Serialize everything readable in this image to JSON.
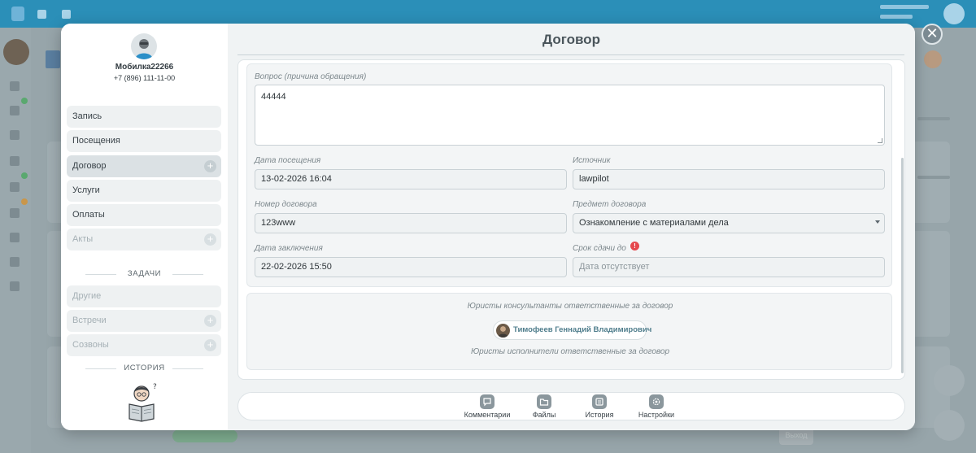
{
  "profile": {
    "name": "Мобилка22266",
    "phone": "+7 (896) 111-11-00"
  },
  "nav": {
    "items": [
      {
        "label": "Запись"
      },
      {
        "label": "Посещения"
      },
      {
        "label": "Договор"
      },
      {
        "label": "Услуги"
      },
      {
        "label": "Оплаты"
      },
      {
        "label": "Акты"
      }
    ],
    "tasks_heading": "ЗАДАЧИ",
    "tasks": [
      {
        "label": "Другие"
      },
      {
        "label": "Встречи"
      },
      {
        "label": "Созвоны"
      }
    ],
    "history_heading": "ИСТОРИЯ"
  },
  "modal": {
    "title": "Договор",
    "close_symbol": "✕"
  },
  "form": {
    "question": {
      "label": "Вопрос (причина обращения)",
      "value": "44444"
    },
    "visit_date": {
      "label": "Дата посещения",
      "value": "13-02-2026 16:04"
    },
    "source": {
      "label": "Источник",
      "value": "lawpilot"
    },
    "contract_number": {
      "label": "Номер договора",
      "value": "123www"
    },
    "contract_subject": {
      "label": "Предмет договора",
      "value": "Ознакомление с материалами дела"
    },
    "conclusion_date": {
      "label": "Дата заключения",
      "value": "22-02-2026 15:50"
    },
    "deadline": {
      "label": "Срок сдачи до",
      "warning_symbol": "!",
      "placeholder": "Дата отсутствует"
    }
  },
  "lawyers": {
    "consultants_label": "Юристы консультанты ответственные за договор",
    "consultant_name": "Тимофеев Геннадий Владимирович",
    "executors_label": "Юристы исполнители ответственные за договор"
  },
  "bottom_bar": {
    "items": [
      {
        "label": "Комментарии",
        "icon": "comment-icon"
      },
      {
        "label": "Файлы",
        "icon": "folder-icon"
      },
      {
        "label": "История",
        "icon": "history-icon"
      },
      {
        "label": "Настройки",
        "icon": "gear-icon"
      }
    ]
  },
  "background": {
    "dimmed_button_label": "Выход"
  },
  "colors": {
    "topbar": "#2b8fb8",
    "warning": "#e5484d",
    "lawyer_name": "#4f7d8c",
    "modal_bg": "#f0f3f4"
  }
}
